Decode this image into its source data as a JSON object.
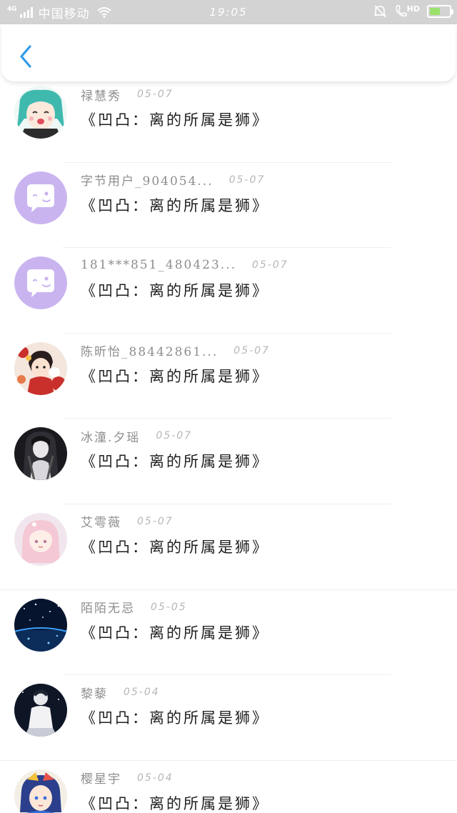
{
  "status_bar": {
    "network": "4G",
    "carrier": "中国移动",
    "time": "19:05",
    "hd": "HD",
    "battery_level": 0.45,
    "icons": [
      "signal-icon",
      "wifi-icon",
      "bell-mute-icon",
      "call-hd-icon",
      "battery-icon"
    ]
  },
  "header": {
    "back_icon": "chevron-left-icon"
  },
  "colors": {
    "accent": "#2f9be8",
    "avatar_default": "#c9b4f0"
  },
  "items": [
    {
      "name": "禄慧秀",
      "date": "05-07",
      "message": "《凹凸：离的所属是狮》",
      "avatar": "anime-teal"
    },
    {
      "name": "字节用户_904054...",
      "date": "05-07",
      "message": "《凹凸：离的所属是狮》",
      "avatar": "default"
    },
    {
      "name": "181***851_480423...",
      "date": "05-07",
      "message": "《凹凸：离的所属是狮》",
      "avatar": "default"
    },
    {
      "name": "陈昕怡_88442861...",
      "date": "05-07",
      "message": "《凹凸：离的所属是狮》",
      "avatar": "red-art"
    },
    {
      "name": "冰潼.夕瑶",
      "date": "05-07",
      "message": "《凹凸：离的所属是狮》",
      "avatar": "dark-art"
    },
    {
      "name": "艾雩薇",
      "date": "05-07",
      "message": "《凹凸：离的所属是狮》",
      "avatar": "pink-art"
    },
    {
      "name": "陌陌无忌",
      "date": "05-05",
      "message": "《凹凸：离的所属是狮》",
      "avatar": "night-sky"
    },
    {
      "name": "黎藜",
      "date": "05-04",
      "message": "《凹凸：离的所属是狮》",
      "avatar": "night-figure"
    },
    {
      "name": "樱星宇",
      "date": "05-04",
      "message": "《凹凸：离的所属是狮》",
      "avatar": "anime-colorful"
    }
  ]
}
